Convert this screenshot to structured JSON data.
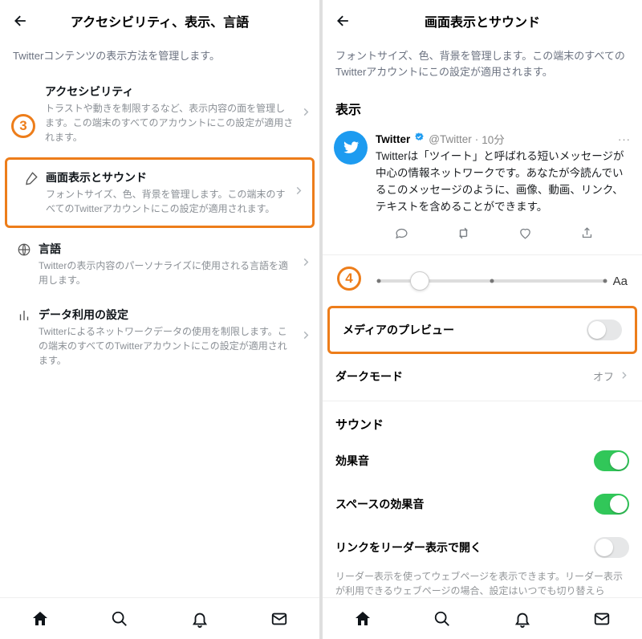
{
  "left": {
    "header_title": "アクセシビリティ、表示、言語",
    "subtitle": "Twitterコンテンツの表示方法を管理します。",
    "items": [
      {
        "title": "アクセシビリティ",
        "desc": "トラストや動きを制限するなど、表示内容の面を管理します。この端末のすべてのアカウントにこの設定が適用されます。"
      },
      {
        "title": "画面表示とサウンド",
        "desc": "フォントサイズ、色、背景を管理します。この端末のすべてのTwitterアカウントにこの設定が適用されます。"
      },
      {
        "title": "言語",
        "desc": "Twitterの表示内容のパーソナライズに使用される言語を適用します。"
      },
      {
        "title": "データ利用の設定",
        "desc": "Twitterによるネットワークデータの使用を制限します。この端末のすべてのTwitterアカウントにこの設定が適用されます。"
      }
    ],
    "badge3": "3"
  },
  "right": {
    "header_title": "画面表示とサウンド",
    "subtitle": "フォントサイズ、色、背景を管理します。この端末のすべてのTwitterアカウントにこの設定が適用されます。",
    "section_display": "表示",
    "tweet": {
      "name": "Twitter",
      "handle": "@Twitter",
      "time": "10分",
      "body": "Twitterは「ツイート」と呼ばれる短いメッセージが中心の情報ネットワークです。あなたが今読んでいるこのメッセージのように、画像、動画、リンク、テキストを含めることができます。"
    },
    "aa": "Aa",
    "badge4": "4",
    "rows": {
      "media_preview": "メディアのプレビュー",
      "dark_mode": "ダークモード",
      "dark_mode_value": "オフ",
      "sound_section": "サウンド",
      "sound_effect": "効果音",
      "space_sound": "スペースの効果音",
      "reader_link": "リンクをリーダー表示で開く"
    },
    "reader_desc": "リーダー表示を使ってウェブページを表示できます。リーダー表示が利用できるウェブページの場合、設定はいつでも切り替えら"
  }
}
